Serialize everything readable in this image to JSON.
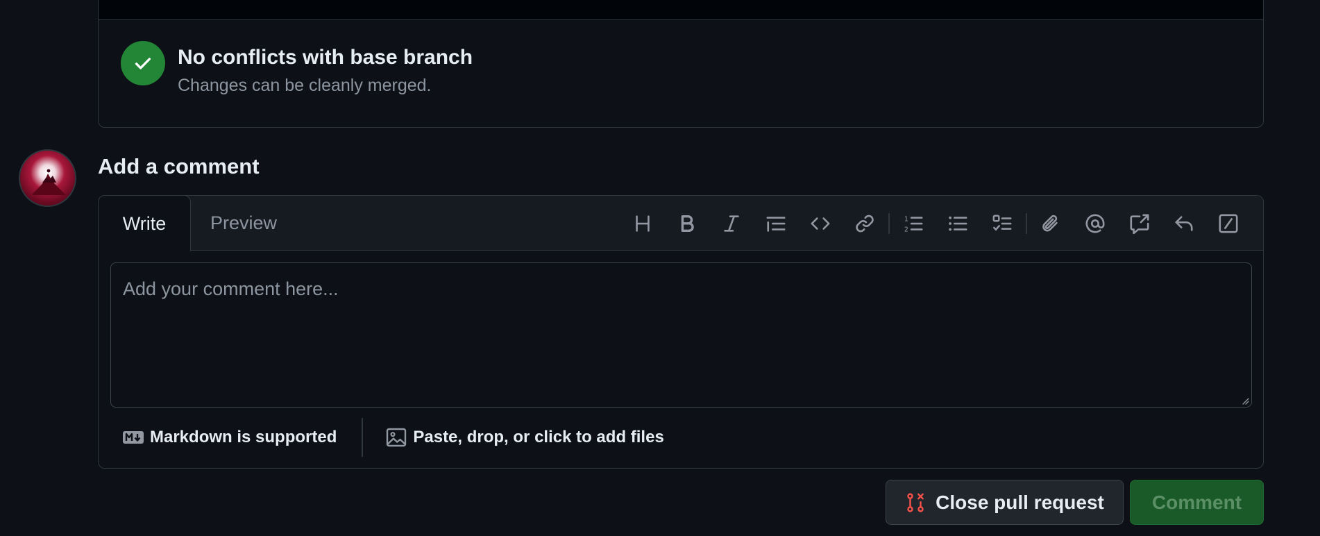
{
  "merge_status": {
    "title": "No conflicts with base branch",
    "subtitle": "Changes can be cleanly merged.",
    "icon": "check-icon",
    "status_color": "#238636"
  },
  "comment": {
    "heading": "Add a comment",
    "tabs": [
      {
        "label": "Write",
        "selected": true
      },
      {
        "label": "Preview",
        "selected": false
      }
    ],
    "toolbar": [
      {
        "name": "heading-icon",
        "title": "Heading"
      },
      {
        "name": "bold-icon",
        "title": "Bold"
      },
      {
        "name": "italic-icon",
        "title": "Italic"
      },
      {
        "name": "quote-icon",
        "title": "Quote"
      },
      {
        "name": "code-icon",
        "title": "Code"
      },
      {
        "name": "link-icon",
        "title": "Link"
      },
      {
        "name": "numbered-list-icon",
        "title": "Numbered list"
      },
      {
        "name": "unordered-list-icon",
        "title": "Unordered list"
      },
      {
        "name": "task-list-icon",
        "title": "Task list"
      },
      {
        "name": "attach-icon",
        "title": "Attach files"
      },
      {
        "name": "mention-icon",
        "title": "Mention"
      },
      {
        "name": "reference-icon",
        "title": "Reference"
      },
      {
        "name": "reply-icon",
        "title": "Saved replies"
      },
      {
        "name": "slash-command-icon",
        "title": "Slash commands"
      }
    ],
    "textarea": {
      "placeholder": "Add your comment here...",
      "value": ""
    },
    "footer": {
      "markdown_label": "Markdown is supported",
      "files_label": "Paste, drop, or click to add files"
    }
  },
  "actions": {
    "close_label": "Close pull request",
    "comment_label": "Comment",
    "close_icon_color": "#f85149",
    "comment_color": "#238636"
  }
}
